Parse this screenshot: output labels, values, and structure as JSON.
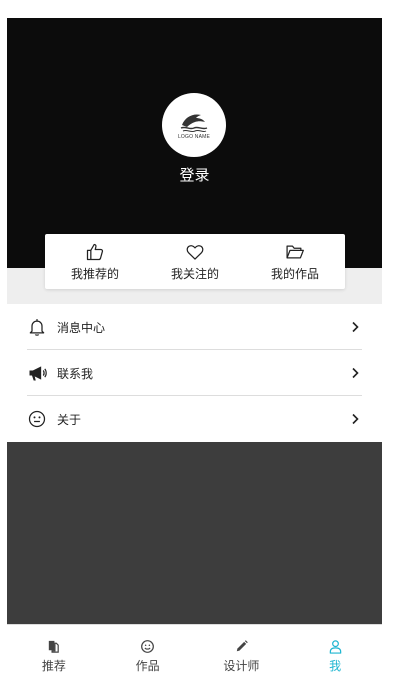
{
  "profile": {
    "logo_text": "LOGO NAME",
    "login_label": "登录"
  },
  "quick_actions": [
    {
      "label": "我推荐的",
      "icon": "thumbs-up-icon"
    },
    {
      "label": "我关注的",
      "icon": "heart-icon"
    },
    {
      "label": "我的作品",
      "icon": "folder-open-icon"
    }
  ],
  "menu": [
    {
      "label": "消息中心",
      "icon": "bell-icon"
    },
    {
      "label": "联系我",
      "icon": "megaphone-icon"
    },
    {
      "label": "关于",
      "icon": "smiley-icon"
    }
  ],
  "tabbar": {
    "items": [
      {
        "label": "推荐",
        "icon": "document-copy-icon"
      },
      {
        "label": "作品",
        "icon": "smiley-icon"
      },
      {
        "label": "设计师",
        "icon": "pencil-icon"
      },
      {
        "label": "我",
        "icon": "user-icon"
      }
    ],
    "active_index": 3
  },
  "colors": {
    "hero_bg": "#0c0c0c",
    "accent": "#1fb6d1",
    "dark_area": "#3d3d3d"
  }
}
